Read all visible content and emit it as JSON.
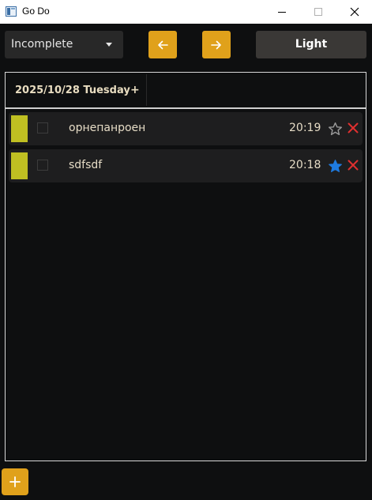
{
  "window": {
    "title": "Go Do"
  },
  "toolbar": {
    "filter": {
      "selected": "Incomplete"
    },
    "prev_icon": "arrow-left-icon",
    "next_icon": "arrow-right-icon",
    "theme_label": "Light"
  },
  "tabs": [
    {
      "label": "2025/10/28 Tuesday",
      "add_label": "+"
    }
  ],
  "tasks": [
    {
      "text": "орнепанроен",
      "time": "20:19",
      "starred": false,
      "completed": false,
      "color": "#bfbf22"
    },
    {
      "text": "sdfsdf",
      "time": "20:18",
      "starred": true,
      "completed": false,
      "color": "#bfbf22"
    }
  ],
  "colors": {
    "accent": "#e0a11b",
    "background": "#0e0f10",
    "star_active": "#1e7be0",
    "delete": "#e03030"
  },
  "fab": {
    "icon": "plus-icon"
  }
}
